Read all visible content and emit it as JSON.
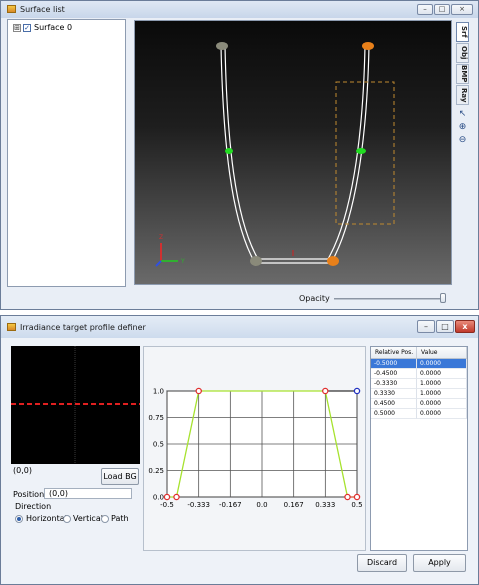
{
  "window1": {
    "title": "Surface list",
    "controls": {
      "minimize": "–",
      "maximize": "□",
      "close": "×"
    },
    "tree": {
      "expander": "⊞",
      "check": "✓",
      "item_label": "Surface 0"
    },
    "tabs": [
      "Srf",
      "Obj",
      "BMP",
      "Ray"
    ],
    "tools": [
      "pointer-icon",
      "zoom-in-icon",
      "zoom-out-icon"
    ],
    "opacity_label": "Opacity",
    "opacity_value": 1.0,
    "axis_labels": {
      "z": "Z",
      "y": "Y"
    },
    "colors": {
      "profile": "#ffffff",
      "marker_orange": "#e8801a",
      "marker_green": "#22dd22",
      "marker_gray": "#8a8a7a",
      "selection_box": "#c08a30"
    }
  },
  "window2": {
    "title": "Irradiance target profile definer",
    "controls": {
      "minimize": "–",
      "maximize": "□",
      "close": "x"
    },
    "coord_label": "(0,0)",
    "load_bg_label": "Load BG",
    "position_label": "Position:",
    "position_value": "(0,0)",
    "direction_label": "Direction",
    "directions": [
      "Horizontal",
      "Vertical",
      "Path"
    ],
    "selected_direction": "Horizontal",
    "table": {
      "headers": [
        "Relative Pos.",
        "Value"
      ],
      "rows": [
        [
          "-0.5000",
          "0.0000"
        ],
        [
          "-0.4500",
          "0.0000"
        ],
        [
          "-0.3330",
          "1.0000"
        ],
        [
          "0.3330",
          "1.0000"
        ],
        [
          "0.4500",
          "0.0000"
        ],
        [
          "0.5000",
          "0.0000"
        ]
      ],
      "selected_row": 0
    },
    "discard_label": "Discard",
    "apply_label": "Apply"
  },
  "chart_data": {
    "type": "line",
    "x": [
      -0.5,
      -0.45,
      -0.333,
      0.333,
      0.45,
      0.5
    ],
    "y": [
      0.0,
      0.0,
      1.0,
      1.0,
      0.0,
      0.0
    ],
    "xlim": [
      -0.5,
      0.5
    ],
    "ylim": [
      0.0,
      1.0
    ],
    "xticks": [
      "-0.5",
      "-0.333",
      "-0.167",
      "0.0",
      "0.167",
      "0.333",
      "0.5"
    ],
    "yticks": [
      "0.0",
      "0.25",
      "0.5",
      "0.75",
      "1.0"
    ],
    "grid": true,
    "colors": {
      "line": "#a6e22e",
      "point": "#e03030",
      "endpoint": "#2030c0"
    }
  }
}
